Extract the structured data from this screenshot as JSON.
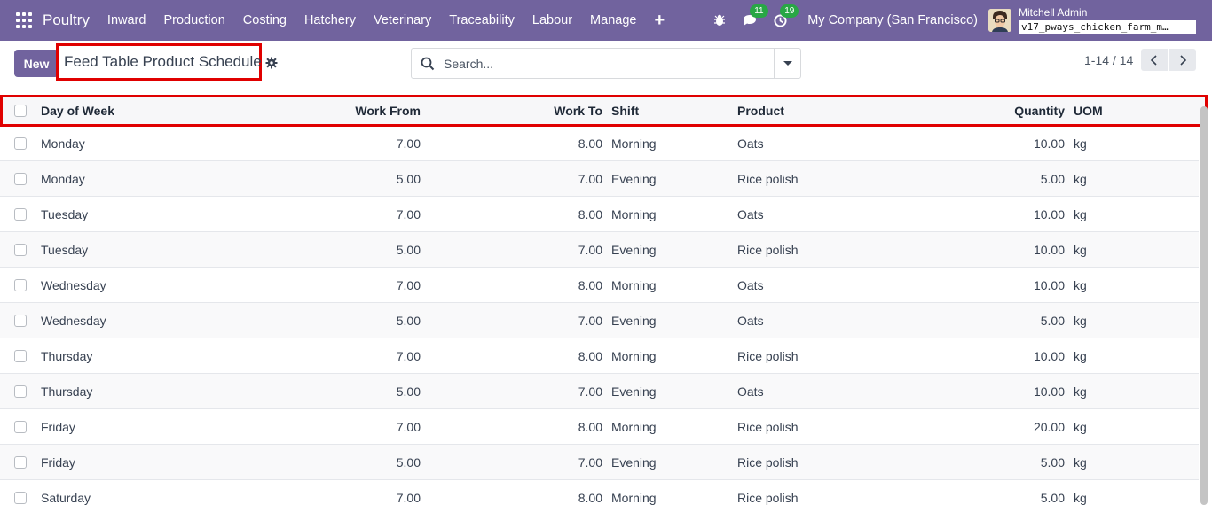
{
  "navbar": {
    "brand": "Poultry",
    "menu": [
      "Inward",
      "Production",
      "Costing",
      "Hatchery",
      "Veterinary",
      "Traceability",
      "Labour",
      "Manage"
    ],
    "plus": "+",
    "messages_count": "11",
    "activities_count": "19",
    "company": "My Company (San Francisco)",
    "user_name": "Mitchell Admin",
    "database": "v17_pways_chicken_farm_m…"
  },
  "control": {
    "new_label": "New",
    "title": "Feed Table Product Schedule",
    "search_placeholder": "Search...",
    "pager": "1-14 / 14"
  },
  "table": {
    "headers": {
      "day": "Day of Week",
      "work_from": "Work From",
      "work_to": "Work To",
      "shift": "Shift",
      "product": "Product",
      "quantity": "Quantity",
      "uom": "UOM"
    },
    "rows": [
      {
        "day": "Monday",
        "work_from": "7.00",
        "work_to": "8.00",
        "shift": "Morning",
        "product": "Oats",
        "quantity": "10.00",
        "uom": "kg"
      },
      {
        "day": "Monday",
        "work_from": "5.00",
        "work_to": "7.00",
        "shift": "Evening",
        "product": "Rice polish",
        "quantity": "5.00",
        "uom": "kg"
      },
      {
        "day": "Tuesday",
        "work_from": "7.00",
        "work_to": "8.00",
        "shift": "Morning",
        "product": "Oats",
        "quantity": "10.00",
        "uom": "kg"
      },
      {
        "day": "Tuesday",
        "work_from": "5.00",
        "work_to": "7.00",
        "shift": "Evening",
        "product": "Rice polish",
        "quantity": "10.00",
        "uom": "kg"
      },
      {
        "day": "Wednesday",
        "work_from": "7.00",
        "work_to": "8.00",
        "shift": "Morning",
        "product": "Oats",
        "quantity": "10.00",
        "uom": "kg"
      },
      {
        "day": "Wednesday",
        "work_from": "5.00",
        "work_to": "7.00",
        "shift": "Evening",
        "product": "Oats",
        "quantity": "5.00",
        "uom": "kg"
      },
      {
        "day": "Thursday",
        "work_from": "7.00",
        "work_to": "8.00",
        "shift": "Morning",
        "product": "Rice polish",
        "quantity": "10.00",
        "uom": "kg"
      },
      {
        "day": "Thursday",
        "work_from": "5.00",
        "work_to": "7.00",
        "shift": "Evening",
        "product": "Oats",
        "quantity": "10.00",
        "uom": "kg"
      },
      {
        "day": "Friday",
        "work_from": "7.00",
        "work_to": "8.00",
        "shift": "Morning",
        "product": "Rice polish",
        "quantity": "20.00",
        "uom": "kg"
      },
      {
        "day": "Friday",
        "work_from": "5.00",
        "work_to": "7.00",
        "shift": "Evening",
        "product": "Rice polish",
        "quantity": "5.00",
        "uom": "kg"
      },
      {
        "day": "Saturday",
        "work_from": "7.00",
        "work_to": "8.00",
        "shift": "Morning",
        "product": "Rice polish",
        "quantity": "5.00",
        "uom": "kg"
      }
    ]
  }
}
